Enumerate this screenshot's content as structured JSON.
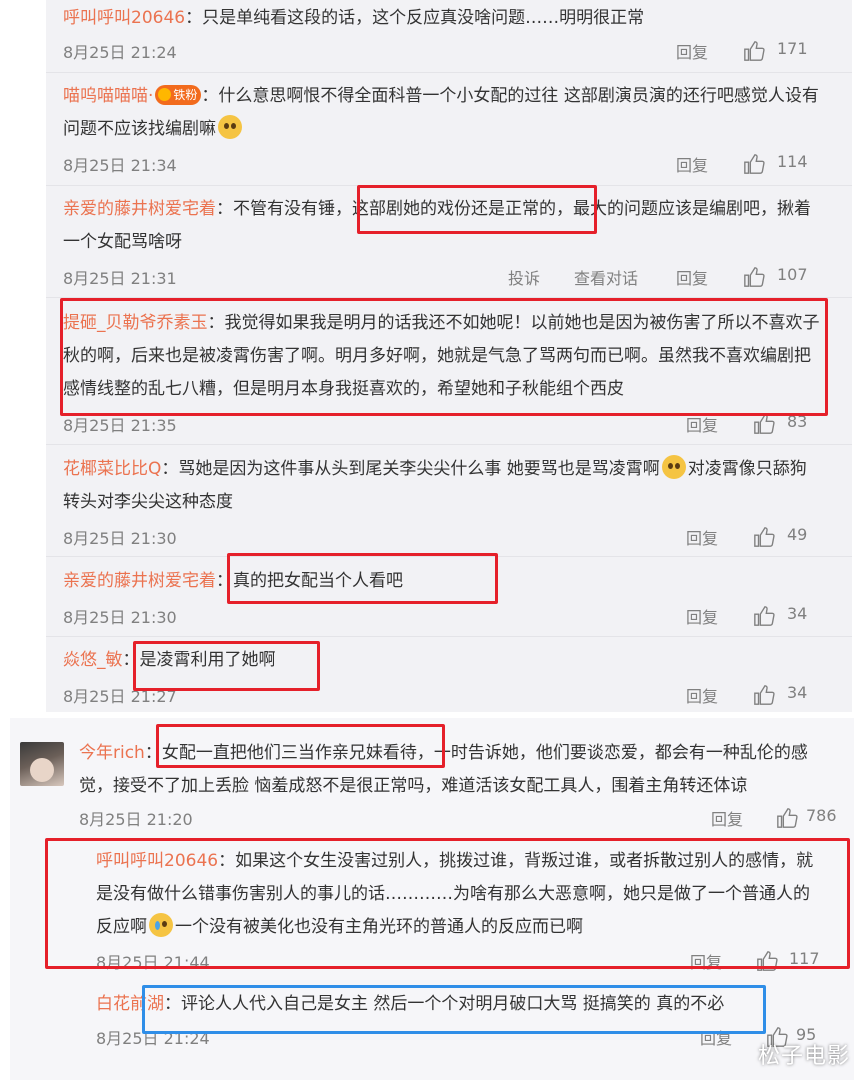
{
  "comments": [
    {
      "user": "呼叫呼叫20646",
      "text": "：只是单纯看这段的话，这个反应真没啥问题……明明很正常",
      "time": "8月25日 21:24",
      "reply": "回复",
      "likes": "171"
    },
    {
      "user": "喵呜喵喵喵·",
      "badge": "铁粉",
      "text": "：什么意思啊恨不得全面科普一个小女配的过往  这部剧演员演的还行吧感觉人设有问题不应该找编剧嘛",
      "emoji": "doubt-emoji",
      "time": "8月25日 21:34",
      "reply": "回复",
      "likes": "114"
    },
    {
      "user": "亲爱的藤井树爱宅着",
      "text": "：不管有没有锤，这部剧她的戏份还是正常的，最大的问题应该是编剧吧，揪着一个女配骂啥呀",
      "time": "8月25日 21:31",
      "report": "投诉",
      "view_dialog": "查看对话",
      "reply": "回复",
      "likes": "107"
    },
    {
      "user": "提砸_贝勒爷乔素玉",
      "text": "：我觉得如果我是明月的话我还不如她呢！以前她也是因为被伤害了所以不喜欢子秋的啊，后来也是被凌霄伤害了啊。明月多好啊，她就是气急了骂两句而已啊。虽然我不喜欢编剧把感情线整的乱七八糟，但是明月本身我挺喜欢的，希望她和子秋能组个西皮",
      "time": "8月25日 21:35",
      "reply": "回复",
      "likes": "83"
    },
    {
      "user": "花椰菜比比Q",
      "text": "：骂她是因为这件事从头到尾关李尖尖什么事 她要骂也是骂凌霄啊",
      "text2": "对凌霄像只舔狗转头对李尖尖这种态度",
      "emoji": "doubt-emoji",
      "time": "8月25日 21:30",
      "reply": "回复",
      "likes": "49"
    },
    {
      "user": "亲爱的藤井树爱宅着",
      "text": "：真的把女配当个人看吧",
      "time": "8月25日 21:30",
      "reply": "回复",
      "likes": "34"
    },
    {
      "user": "焱悠_敏",
      "text": "：是凌霄利用了她啊",
      "time": "8月25日 21:27",
      "reply": "回复",
      "likes": "34"
    }
  ],
  "main_comment": {
    "user": "今年rich",
    "text": "：女配一直把他们三当作亲兄妹看待，一时告诉她，他们要谈恋爱，都会有一种乱伦的感觉，接受不了加上丢脸 恼羞成怒不是很正常吗，难道活该女配工具人，围着主角转还体谅",
    "time": "8月25日 21:20",
    "reply": "回复",
    "likes": "786"
  },
  "replies": [
    {
      "user": "呼叫呼叫20646",
      "text": "：如果这个女生没害过别人，挑拨过谁，背叛过谁，或者拆散过别人的感情，就是没有做什么错事伤害别人的事儿的话…………为啥有那么大恶意啊，她只是做了一个普通人的反应啊",
      "text2": "一个没有被美化也没有主角光环的普通人的反应而已啊",
      "emoji": "cry-laugh-emoji",
      "time": "8月25日 21:44",
      "reply": "回复",
      "likes": "117"
    },
    {
      "user": "白花前湖",
      "text": "：评论人人代入自己是女主 然后一个个对明月破口大骂 挺搞笑的 真的不必",
      "time": "8月25日 21:24",
      "reply": "回复",
      "likes": "95"
    }
  ],
  "watermark": "松子电影",
  "colors": {
    "username": "#eb7350",
    "highlight_red": "#e5202a",
    "highlight_blue": "#2f8ee8",
    "panel_bg": "#f2f2f5"
  }
}
